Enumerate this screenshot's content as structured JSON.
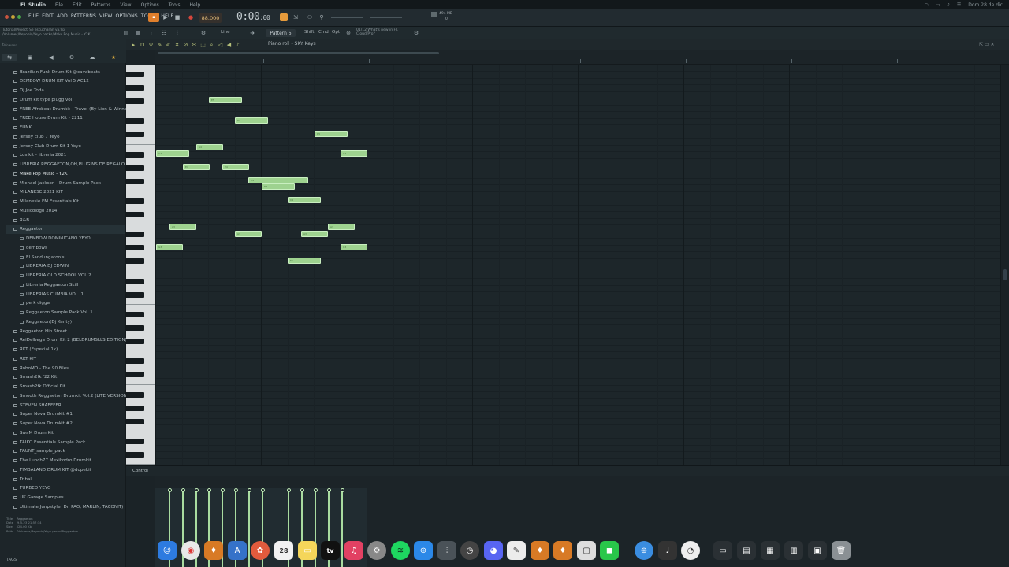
{
  "macos_menubar": {
    "app_name": "FL Studio",
    "items": [
      "File",
      "Edit",
      "Patterns",
      "View",
      "Options",
      "Tools",
      "Help"
    ],
    "datetime": "Dom 28 de dic"
  },
  "fl_menu": {
    "items": [
      "FILE",
      "EDIT",
      "ADD",
      "PATTERNS",
      "VIEW",
      "OPTIONS",
      "TOOLS",
      "HELP"
    ]
  },
  "transport": {
    "tempo": "88.000",
    "time": "0:00",
    "time_sub": ":00",
    "cpu_text": "494 MB",
    "cpu_val": "0"
  },
  "toolbar2": {
    "path_line1": "Tutorial/Project_Se escucharan ya.flp",
    "path_line2": "/Volumes/Reyoblo/Yeyo packs/Make Pop Music - Y2K",
    "snap": "Line",
    "pattern": "Pattern 5",
    "shift": "Shift",
    "cmd": "Cmd",
    "opt": "Opt",
    "news_line1": "01/12  What's new in FL",
    "news_line2": "Cloud/Pro?"
  },
  "browser": {
    "search_placeholder": "Browser",
    "items": [
      {
        "label": "Brazilian Funk Drum Kit @cavabeats",
        "level": 0
      },
      {
        "label": "DEMBOW DRUM KIT Vol 5 AC12",
        "level": 0
      },
      {
        "label": "Dj Joe Toda",
        "level": 0
      },
      {
        "label": "Drum kit type plugg vol",
        "level": 0
      },
      {
        "label": "FREE Afrobeat Drumkit - Travel (By Lion & Winner)",
        "level": 0
      },
      {
        "label": "FREE House Drum Kit - 2211",
        "level": 0
      },
      {
        "label": "FUNK",
        "level": 0
      },
      {
        "label": "Jersey club 7 Yeyo",
        "level": 0
      },
      {
        "label": "Jersey Club Drum Kit 1 Yeyo",
        "level": 0
      },
      {
        "label": "Los kit - libreria 2021",
        "level": 0
      },
      {
        "label": "LIBRERIA REGGAETON,OH,PLUGINS DE REGALO !",
        "level": 0
      },
      {
        "label": "Make Pop Music - Y2K",
        "level": 0,
        "selected": true
      },
      {
        "label": "Michael Jackson - Drum Sample Pack",
        "level": 0
      },
      {
        "label": "MILANESE 2021 KIT",
        "level": 0
      },
      {
        "label": "Milanesie FM Essentials Kit",
        "level": 0
      },
      {
        "label": "Musicologo 2014",
        "level": 0
      },
      {
        "label": "R&B",
        "level": 0
      },
      {
        "label": "Reggaeton",
        "level": 0,
        "open": true
      },
      {
        "label": "DEMBOW DOMINICANO YEYO",
        "level": 1
      },
      {
        "label": "dembows",
        "level": 1
      },
      {
        "label": "El Sandungatools",
        "level": 1
      },
      {
        "label": "LIBRERIA DJ EDWIN",
        "level": 1
      },
      {
        "label": "LIBRERIA OLD SCHOOL VOL 2",
        "level": 1
      },
      {
        "label": "Libreria Reggaeton Skill",
        "level": 1
      },
      {
        "label": "LIBRERIAS CUMBIA VOL. 1",
        "level": 1
      },
      {
        "label": "perk digga",
        "level": 1
      },
      {
        "label": "Reggaeton Sample Pack Vol. 1",
        "level": 1
      },
      {
        "label": "Reggaeton(Dj Kenty)",
        "level": 1
      },
      {
        "label": "Reggaeton Hip Street",
        "level": 0
      },
      {
        "label": "ReiDelbega Drum Kit 2 (BELDRUMSLLS EDITION)",
        "level": 0
      },
      {
        "label": "RKT (Especial 1k)",
        "level": 0
      },
      {
        "label": "RKT KIT",
        "level": 0
      },
      {
        "label": "RoboMD - The 90 Files",
        "level": 0
      },
      {
        "label": "Smash2fk '22 Kit",
        "level": 0
      },
      {
        "label": "Smash2fk Official Kit",
        "level": 0
      },
      {
        "label": "Smooth Reggaeton Drumkit Vol.2 (LITE VERSION)",
        "level": 0
      },
      {
        "label": "STEVEN SHAEFFER",
        "level": 0
      },
      {
        "label": "Super Nova Drumkit #1",
        "level": 0
      },
      {
        "label": "Super Nova Drumkit #2",
        "level": 0
      },
      {
        "label": "SwaM Drum Kit",
        "level": 0
      },
      {
        "label": "TAIKO Essentials Sample Pack",
        "level": 0
      },
      {
        "label": "TAUNT_sample_pack",
        "level": 0
      },
      {
        "label": "The Lunch77 Mexikodro Drumkit",
        "level": 0
      },
      {
        "label": "TIMBALAND DRUM KIT @dopekit",
        "level": 0
      },
      {
        "label": "Tribal",
        "level": 0
      },
      {
        "label": "TURBEO YEYO",
        "level": 0
      },
      {
        "label": "UK Garage Samples",
        "level": 0
      },
      {
        "label": "Ultimate Junpstyler Dr. PAO, MARLIN, TACONIT)",
        "level": 0
      }
    ],
    "info_title_label": "Title",
    "info_title": "Reggaeton",
    "info_date_label": "Date",
    "info_date": "9-5-23 21:57:34",
    "info_size_label": "Size",
    "info_size": "524.00 Kb",
    "info_path_label": "Path",
    "info_path": "/Volumes/Reyoblo/Yeyo packs/Reggaeton",
    "tags": "TAGS"
  },
  "piano_roll": {
    "title": "Piano roll - SKY Keys",
    "notes": [
      {
        "pitch_row": 55,
        "start": 68,
        "len": 42,
        "label": "E5"
      },
      {
        "pitch_row": 52,
        "start": 101,
        "len": 42,
        "label": "D5"
      },
      {
        "pitch_row": 50,
        "start": 202,
        "len": 42,
        "label": "D5"
      },
      {
        "pitch_row": 48,
        "start": 52,
        "len": 34,
        "label": "A4"
      },
      {
        "pitch_row": 47,
        "start": 1,
        "len": 42,
        "label": "G4"
      },
      {
        "pitch_row": 47,
        "start": 235,
        "len": 34,
        "label": "G4"
      },
      {
        "pitch_row": 45,
        "start": 35,
        "len": 34,
        "label": "E4"
      },
      {
        "pitch_row": 45,
        "start": 85,
        "len": 34,
        "label": "E4"
      },
      {
        "pitch_row": 43,
        "start": 118,
        "len": 76,
        "label": "D4"
      },
      {
        "pitch_row": 42,
        "start": 135,
        "len": 42,
        "label": "D4"
      },
      {
        "pitch_row": 40,
        "start": 168,
        "len": 42,
        "label": "C4"
      },
      {
        "pitch_row": 36,
        "start": 18,
        "len": 34,
        "label": "A3"
      },
      {
        "pitch_row": 36,
        "start": 219,
        "len": 34,
        "label": "A3"
      },
      {
        "pitch_row": 35,
        "start": 101,
        "len": 34,
        "label": "A3"
      },
      {
        "pitch_row": 35,
        "start": 185,
        "len": 34,
        "label": "A3"
      },
      {
        "pitch_row": 33,
        "start": 1,
        "len": 34,
        "label": "G3"
      },
      {
        "pitch_row": 33,
        "start": 235,
        "len": 34,
        "label": "G3"
      },
      {
        "pitch_row": 31,
        "start": 168,
        "len": 42,
        "label": "F3"
      }
    ],
    "velocities": [
      17,
      34,
      51,
      67,
      84,
      101,
      118,
      135,
      168,
      185,
      202,
      219,
      236
    ]
  },
  "control": {
    "label": "Control"
  },
  "dock": {
    "calendar_day": "28",
    "tv_label": "tv"
  }
}
